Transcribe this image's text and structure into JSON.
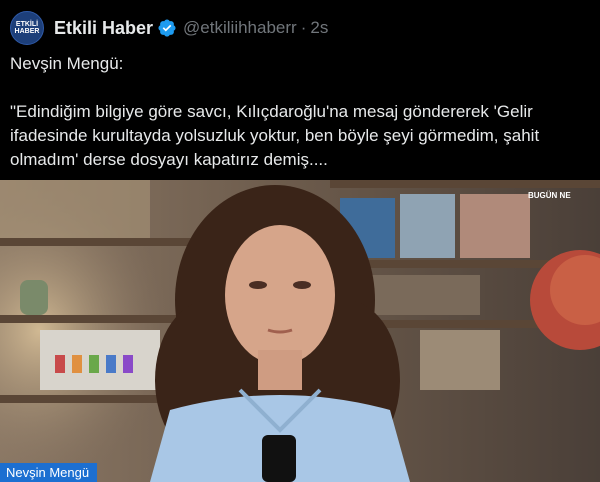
{
  "account": {
    "avatar_text": "ETKİLİ HABER",
    "display_name": "Etkili Haber",
    "handle": "@etkiliihhaberr",
    "separator": "·",
    "time": "2s",
    "verified_color": "#1d9bf0"
  },
  "tweet": {
    "lead": "Nevşin Mengü:",
    "quote": "\"Edindiğim bilgiye göre savcı, Kılıçdaroğlu'na mesaj göndererek 'Gelir ifadesinde kurultayda yolsuzluk yoktur, ben böyle şeyi görmedim, şahit olmadım' derse dosyayı kapatırız demiş...."
  },
  "media": {
    "channel_logo": "BUGÜN NE",
    "name_tag": "Nevşin Mengü"
  },
  "colors": {
    "background": "#000000",
    "text": "#e7e9ea",
    "muted": "#71767b",
    "name_tag": "#1c6fd1"
  }
}
